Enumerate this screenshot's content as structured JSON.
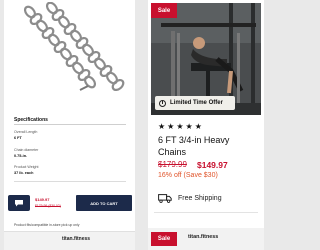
{
  "left_panel": {
    "specs_title": "Specifications",
    "specs": [
      {
        "label": "Overall Length",
        "value": "6 FT"
      },
      {
        "label": "Chain diameter",
        "value": "0.75-in."
      },
      {
        "label": "Product Weight",
        "value": "37 lb. each"
      }
    ],
    "cart": {
      "price_new": "$149.97",
      "price_old": "$179.99 ($30.02)",
      "button_label": "ADD TO CART"
    },
    "footer_text": "Product fits/compatible in-store pick up only",
    "brand": "titan.fitness"
  },
  "right_panel": {
    "sale_badge": "Sale",
    "limited_time": "Limited Time Offer",
    "stars": "★★★★★",
    "title": "6 FT 3/4-in Heavy Chains",
    "price_old": "$179.99",
    "price_new": "$149.97",
    "discount": "16% off (Save $30)",
    "shipping": "Free Shipping",
    "bottom_sale_badge": "Sale",
    "brand": "titan.fitness"
  },
  "colors": {
    "sale_red": "#c8102e",
    "discount_orange": "#e0542a",
    "navy": "#1c2a4a"
  }
}
